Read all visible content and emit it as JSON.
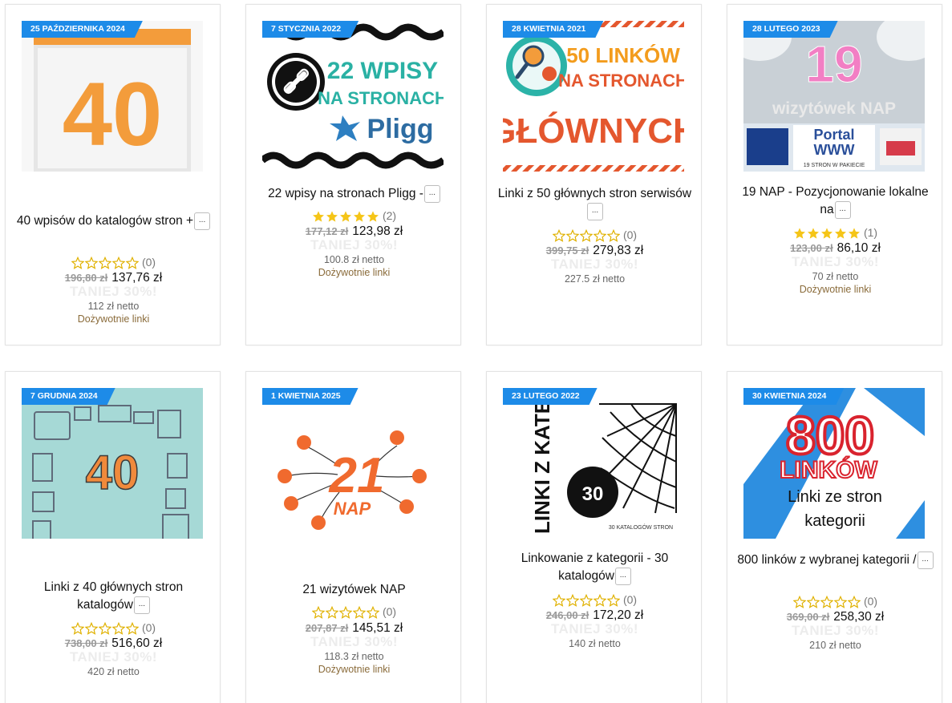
{
  "colors": {
    "badge": "#1d8be8",
    "star": "#f5c518",
    "star_empty_stroke": "#e0b100",
    "promo": "#ececec",
    "lifetime": "#8a6b3a"
  },
  "more_label": "...",
  "cards": [
    {
      "date": "25 PAŹDZIERNIKA 2024",
      "title": "40 wpisów do katalogów stron +",
      "rating_count": "(0)",
      "stars": 0,
      "old_price": "196,80 zł",
      "price": "137,76 zł",
      "promo": "TANIEJ 30%!",
      "netto": "112 zł netto",
      "lifetime": "Dożywotnie linki",
      "image": {
        "text": "40"
      }
    },
    {
      "date": "7 STYCZNIA 2022",
      "title": "22 wpisy na stronach Pligg -",
      "rating_count": "(2)",
      "stars": 5,
      "old_price": "177,12 zł",
      "price": "123,98 zł",
      "promo": "TANIEJ 30%!",
      "netto": "100.8 zł netto",
      "lifetime": "Dożywotnie linki",
      "image": {
        "line1": "22 WPISY",
        "line2": "NA STRONACH",
        "brand": "Pligg"
      }
    },
    {
      "date": "28 KWIETNIA 2021",
      "title": "Linki z 50 głównych stron serwisów",
      "rating_count": "(0)",
      "stars": 0,
      "old_price": "399,75 zł",
      "price": "279,83 zł",
      "promo": "TANIEJ 30%!",
      "netto": "227.5 zł netto",
      "lifetime": "",
      "image": {
        "line1": "50 LINKÓW",
        "line2": "NA STRONACH",
        "line3": "GŁÓWNYCH"
      }
    },
    {
      "date": "28 LUTEGO 2023",
      "title": "19 NAP - Pozycjonowanie lokalne na",
      "rating_count": "(1)",
      "stars": 5,
      "old_price": "123,00 zł",
      "price": "86,10 zł",
      "promo": "TANIEJ 30%!",
      "netto": "70 zł netto",
      "lifetime": "Dożywotnie linki",
      "image": {
        "num": "19",
        "line1": "wizytówek NAP",
        "line2": "Portal",
        "line3": "WWW",
        "line4": "19 STRON W PAKIECIE"
      }
    },
    {
      "date": "7 GRUDNIA 2024",
      "title": "Linki z 40 głównych stron katalogów",
      "rating_count": "(0)",
      "stars": 0,
      "old_price": "738,00 zł",
      "price": "516,60 zł",
      "promo": "TANIEJ 30%!",
      "netto": "420 zł netto",
      "lifetime": "",
      "image": {
        "text": "40"
      }
    },
    {
      "date": "1 KWIETNIA 2025",
      "title": "21 wizytówek NAP",
      "rating_count": "(0)",
      "stars": 0,
      "old_price": "207,87 zł",
      "price": "145,51 zł",
      "promo": "TANIEJ 30%!",
      "netto": "118.3 zł netto",
      "lifetime": "Dożywotnie linki",
      "image": {
        "num": "21",
        "label": "NAP"
      }
    },
    {
      "date": "23 LUTEGO 2022",
      "title": "Linkowanie z kategorii - 30 katalogów",
      "rating_count": "(0)",
      "stars": 0,
      "old_price": "246,00 zł",
      "price": "172,20 zł",
      "promo": "TANIEJ 30%!",
      "netto": "140 zł netto",
      "lifetime": "",
      "image": {
        "vertical": "LINKI Z KATEGORII",
        "num": "30",
        "caption": "30 KATALOGÓW STRON"
      }
    },
    {
      "date": "30 KWIETNIA 2024",
      "title": "800 linków z wybranej kategorii /",
      "rating_count": "(0)",
      "stars": 0,
      "old_price": "369,00 zł",
      "price": "258,30 zł",
      "promo": "TANIEJ 30%!",
      "netto": "210 zł netto",
      "lifetime": "",
      "image": {
        "num": "800",
        "line1": "LINKÓW",
        "line2": "Linki ze stron",
        "line3": "kategorii"
      }
    }
  ]
}
